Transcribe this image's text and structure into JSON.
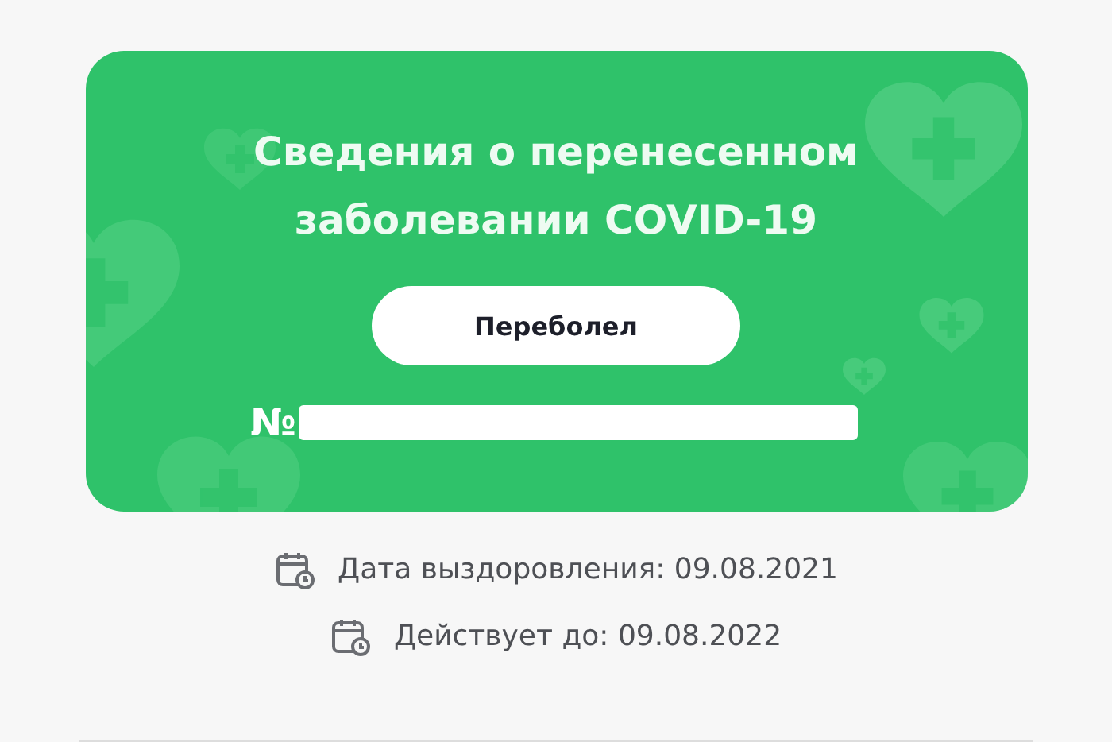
{
  "certificate": {
    "title": "Сведения о перенесенном заболевании COVID-19",
    "status_button": "Переболел",
    "number_label": "№",
    "number_redacted": true
  },
  "details": [
    {
      "text": "Дата выздоровления: 09.08.2021"
    },
    {
      "text": "Действует до: 09.08.2022"
    }
  ]
}
